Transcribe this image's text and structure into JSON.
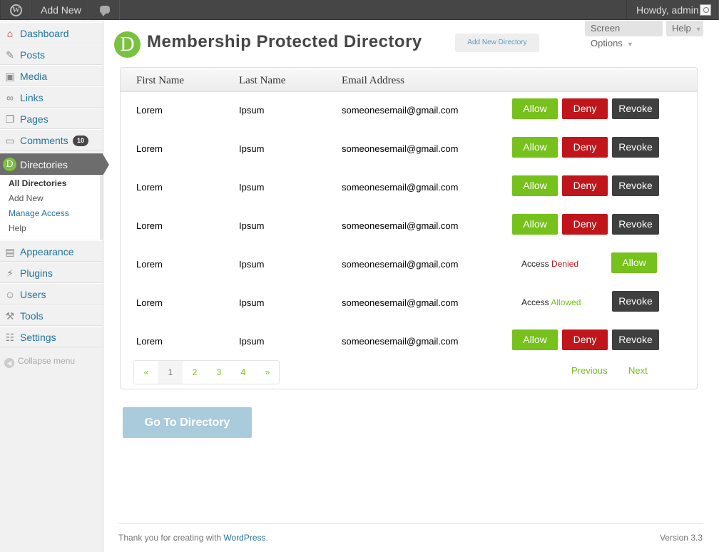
{
  "adminbar": {
    "add_new": "Add New",
    "howdy": "Howdy, admin"
  },
  "sidebar": {
    "items": [
      {
        "label": "Dashboard",
        "icon": "dashboard-icon"
      },
      {
        "label": "Posts",
        "icon": "posts-icon"
      },
      {
        "label": "Media",
        "icon": "media-icon"
      },
      {
        "label": "Links",
        "icon": "links-icon"
      },
      {
        "label": "Pages",
        "icon": "pages-icon"
      },
      {
        "label": "Comments",
        "icon": "comments-icon",
        "badge": "10"
      },
      {
        "label": "Directories",
        "icon": "directories-icon"
      },
      {
        "label": "Appearance",
        "icon": "appearance-icon"
      },
      {
        "label": "Plugins",
        "icon": "plugins-icon"
      },
      {
        "label": "Users",
        "icon": "users-icon"
      },
      {
        "label": "Tools",
        "icon": "tools-icon"
      },
      {
        "label": "Settings",
        "icon": "settings-icon"
      }
    ],
    "submenu": [
      "All Directories",
      "Add New",
      "Manage Access",
      "Help"
    ],
    "collapse": "Collapse menu"
  },
  "header": {
    "screen_options": "Screen Options",
    "help": "Help",
    "logo_letter": "D",
    "title": "Membership Protected Directory",
    "add_new_directory": "Add New Directory"
  },
  "table": {
    "columns": [
      "First Name",
      "Last Name",
      "Email Address"
    ],
    "rows": [
      {
        "first": "Lorem",
        "last": "Ipsum",
        "email": "someonesemail@gmail.com"
      },
      {
        "first": "Lorem",
        "last": "Ipsum",
        "email": "someonesemail@gmail.com"
      },
      {
        "first": "Lorem",
        "last": "Ipsum",
        "email": "someonesemail@gmail.com"
      },
      {
        "first": "Lorem",
        "last": "Ipsum",
        "email": "someonesemail@gmail.com"
      },
      {
        "first": "Lorem",
        "last": "Ipsum",
        "email": "someonesemail@gmail.com",
        "status_prefix": "Access",
        "status": "Denied"
      },
      {
        "first": "Lorem",
        "last": "Ipsum",
        "email": "someonesemail@gmail.com",
        "status_prefix": "Access",
        "status": "Allowed"
      },
      {
        "first": "Lorem",
        "last": "Ipsum",
        "email": "someonesemail@gmail.com"
      }
    ],
    "buttons": {
      "allow": "Allow",
      "deny": "Deny",
      "revoke": "Revoke"
    },
    "pagination": {
      "first": "«",
      "pages": [
        "1",
        "2",
        "3",
        "4"
      ],
      "last": "»",
      "current": "1",
      "previous": "Previous",
      "next": "Next"
    }
  },
  "goto_directory": "Go To Directory",
  "footer": {
    "thanks": "Thank you for creating with ",
    "wordpress": "WordPress",
    "period": ".",
    "version": "Version 3.3"
  },
  "colors": {
    "allow": "#76c11c",
    "deny": "#c0161b",
    "revoke": "#3f3f3f",
    "brand_green": "#7ac142",
    "link_blue": "#21759b"
  }
}
